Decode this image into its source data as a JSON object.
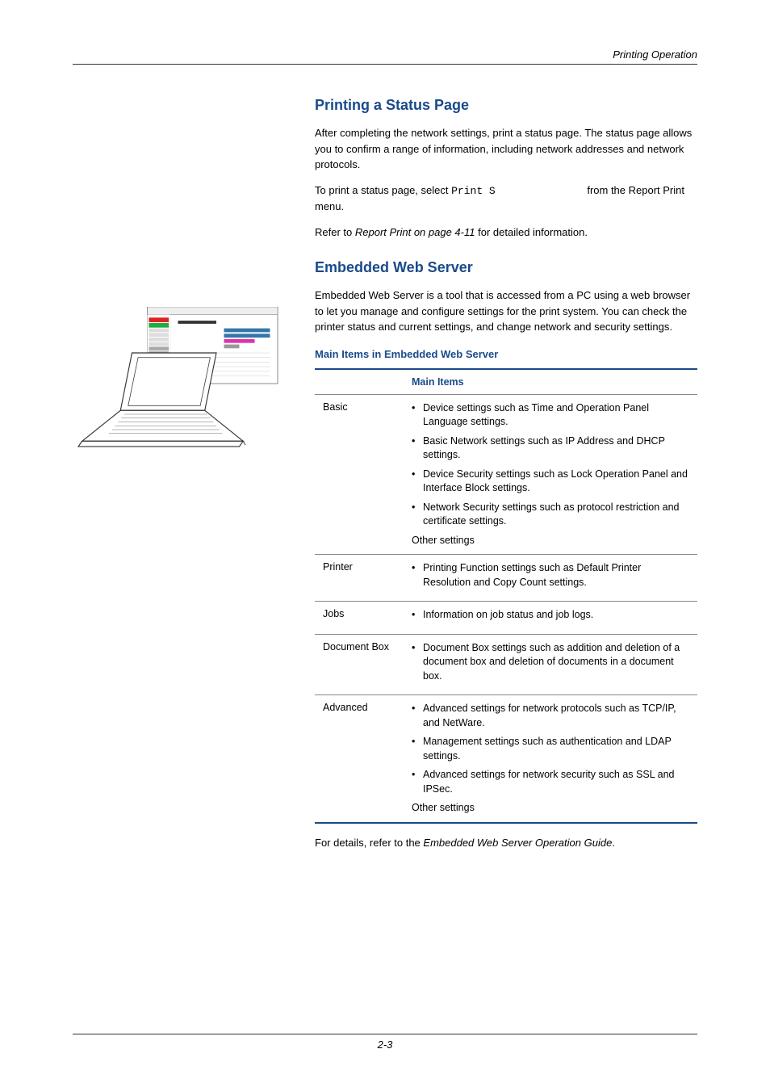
{
  "running_header": "Printing Operation",
  "section1": {
    "title": "Printing a Status Page",
    "p1": "After completing the network settings, print a status page. The status page allows you to confirm a range of information, including network addresses and network protocols.",
    "p2_a": "To print a status page, select ",
    "p2_mono": "Print S",
    "p2_b": " from the Report Print menu.",
    "p3_a": "Refer to ",
    "p3_i": "Report Print on page 4-11",
    "p3_b": " for detailed information."
  },
  "section2": {
    "title": "Embedded Web Server",
    "p1": "Embedded Web Server is a tool that is accessed from a PC using a web browser to let you manage and configure settings for the print system. You can check the printer status and current settings, and change network and security settings.",
    "sub_title": "Main Items in Embedded Web Server",
    "table_header": "Main Items",
    "rows": [
      {
        "name": "Basic",
        "bullets": [
          "Device settings such as Time and Operation Panel Language settings.",
          "Basic Network settings such as IP Address and DHCP settings.",
          "Device Security settings such as Lock Operation Panel and Interface Block settings.",
          "Network Security settings such as protocol restriction and certificate settings."
        ],
        "plain": "Other settings"
      },
      {
        "name": "Printer",
        "bullets": [
          "Printing Function settings such as Default Printer Resolution and Copy Count settings."
        ]
      },
      {
        "name": "Jobs",
        "bullets": [
          "Information on job status and job logs."
        ]
      },
      {
        "name": "Document Box",
        "bullets": [
          "Document Box settings such as addition and deletion of a document box and deletion of documents in a document box."
        ]
      },
      {
        "name": "Advanced",
        "bullets": [
          "Advanced settings for network protocols such as TCP/IP, and NetWare.",
          "Management settings such as authentication and LDAP settings.",
          "Advanced settings for network security such as SSL and IPSec."
        ],
        "plain": "Other settings"
      }
    ],
    "closing_a": "For details, refer to the ",
    "closing_i": "Embedded Web Server Operation Guide",
    "closing_b": "."
  },
  "page_number": "2-3"
}
